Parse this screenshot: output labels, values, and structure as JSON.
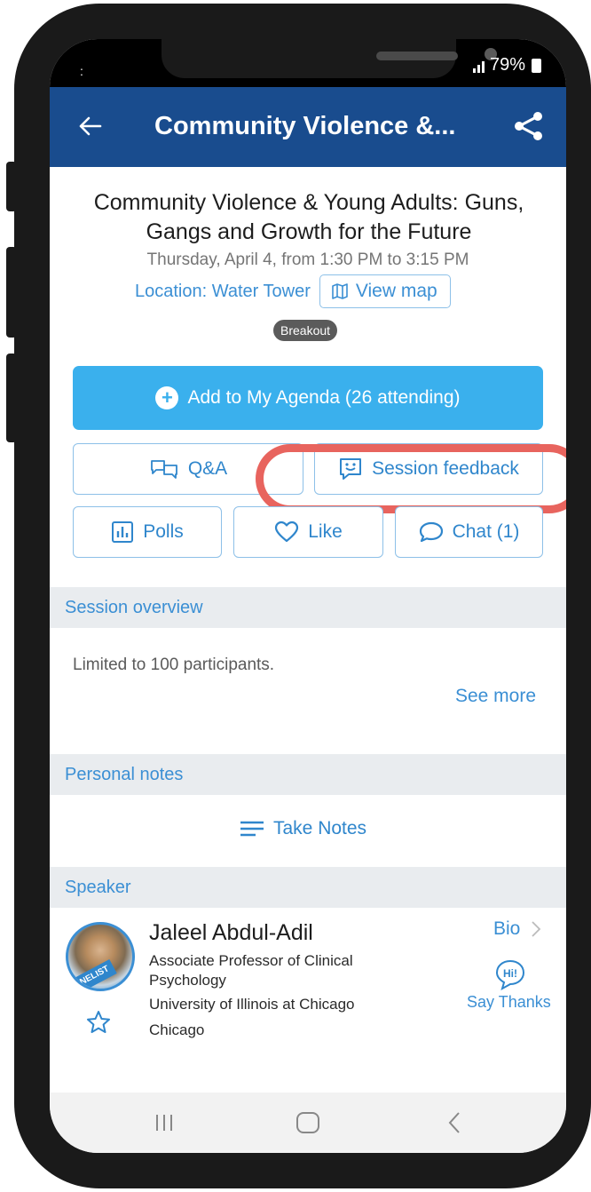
{
  "status_bar": {
    "battery": "79%"
  },
  "header": {
    "back_icon": "arrow-left-icon",
    "title": "Community Violence &...",
    "share_icon": "share-icon",
    "color": "#194c8e"
  },
  "session": {
    "title": "Community Violence & Young Adults: Guns, Gangs and Growth for the Future",
    "time": "Thursday, April 4, from 1:30 PM to 3:15 PM",
    "location": "Location: Water Tower",
    "view_map": "View map",
    "badge": "Breakout"
  },
  "actions": {
    "add_agenda": "Add to My Agenda (26 attending)",
    "qa": "Q&A",
    "feedback": "Session feedback",
    "polls": "Polls",
    "like": "Like",
    "chat": "Chat (1)",
    "accent_color": "#3ab0ed",
    "highlight_color": "#e8645e"
  },
  "overview": {
    "heading": "Session overview",
    "text": "Limited to 100 participants.",
    "see_more": "See more"
  },
  "notes": {
    "heading": "Personal notes",
    "take_notes": "Take Notes"
  },
  "speaker": {
    "heading": "Speaker",
    "name": "Jaleel Abdul-Adil",
    "title_line1": "Associate Professor of Clinical",
    "title_line2": "Psychology",
    "org": "University of Illinois at Chicago",
    "city": "Chicago",
    "badge": "PANELIST",
    "bio": "Bio",
    "hi": "Hi!",
    "say_thanks": "Say Thanks"
  }
}
